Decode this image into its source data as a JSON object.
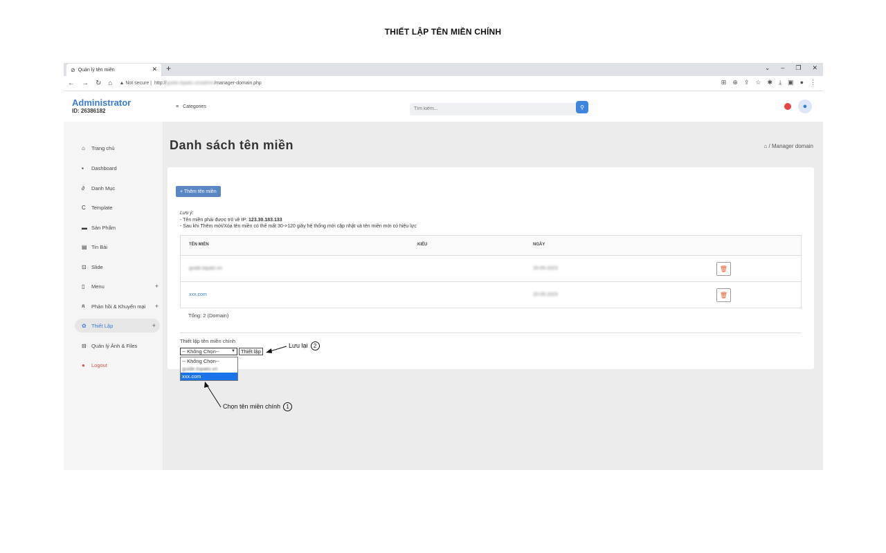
{
  "heading": "THIẾT LẬP TÊN MIỀN CHÍNH",
  "browser": {
    "tab_title": "Quản lý tên miền",
    "url_tail": "/manager-domain.php",
    "url_head": "http://",
    "secure_label": "Not secure"
  },
  "header": {
    "brand": "Administrator",
    "id": "ID: 26386182",
    "categories": "Categories",
    "search_placeholder": "Tìm kiếm..."
  },
  "sidebar": {
    "items": [
      {
        "label": "Trang chủ",
        "icon": "home-icon"
      },
      {
        "label": "Dashboard",
        "icon": "dashboard-icon"
      },
      {
        "label": "Danh Mục",
        "icon": "link-icon"
      },
      {
        "label": "Template",
        "icon": "template-icon"
      },
      {
        "label": "Sản Phẩm",
        "icon": "product-icon"
      },
      {
        "label": "Tin Bài",
        "icon": "news-icon"
      },
      {
        "label": "Slide",
        "icon": "slide-icon"
      },
      {
        "label": "Menu",
        "icon": "menu-icon"
      },
      {
        "label": "Phản hồi & Khuyến mại",
        "icon": "user-icon"
      },
      {
        "label": "Thiết Lập",
        "icon": "gear-icon"
      },
      {
        "label": "Quản lý Ảnh & Files",
        "icon": "files-icon"
      },
      {
        "label": "Logout",
        "icon": "logout-icon"
      }
    ]
  },
  "main": {
    "title": "Danh sách tên miền",
    "breadcrumb": "/ Manager domain",
    "add_button": "+ Thêm tên miền",
    "note_title": "Lưu ý:",
    "note_line1_prefix": "- Tên miền phải được trỏ về IP: ",
    "note_ip": "123.30.183.133",
    "note_line2": "- Sau khi Thêm mới/Xóa tên miền có thể mất 30->120 giây hệ thống mới cập nhật và tên miền mới có hiệu lực",
    "columns": [
      "TÊN MIỀN",
      "KIỂU",
      "NGÀY"
    ],
    "rows": [
      {
        "domain": "guide.topato.vn",
        "date": "20-05-2023"
      },
      {
        "domain": "xxx.com",
        "date": "20-05-2023"
      }
    ],
    "total": "Tổng: 2 (Domain)",
    "set_label": "Thiết lập tên miền chính",
    "select_value": "-- Không Chọn--",
    "set_button": "Thiết lập",
    "options": [
      "-- Không Chọn--",
      "guide.topato.vn",
      "xxx.com"
    ]
  },
  "annotations": {
    "save": "Lưu lại",
    "save_num": "2",
    "choose": "Chọn tên miền chính",
    "choose_num": "1"
  }
}
